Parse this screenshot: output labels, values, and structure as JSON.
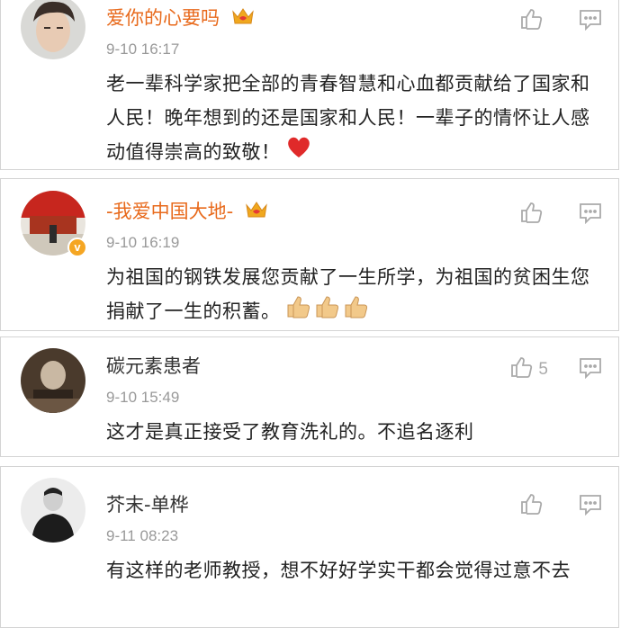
{
  "comments": [
    {
      "username": "爱你的心要吗",
      "time": "9-10 16:17",
      "text": "老一辈科学家把全部的青春智慧和心血都贡献给了国家和人民！晚年想到的还是国家和人民！一辈子的情怀让人感动值得崇高的致敬！",
      "like_count": "",
      "emoji": "heart-emoji"
    },
    {
      "username": "-我爱中国大地-",
      "time": "9-10 16:19",
      "text": "为祖国的钢铁发展您贡献了一生所学，为祖国的贫困生您捐献了一生的积蓄。",
      "like_count": "",
      "emoji": "thumbs-up-emoji"
    },
    {
      "username": "碳元素患者",
      "time": "9-10 15:49",
      "text": "这才是真正接受了教育洗礼的。不追名逐利",
      "like_count": "5"
    },
    {
      "username": "芥末-单桦",
      "time": "9-11 08:23",
      "text": "有这样的老师教授，想不好好学实干都会觉得过意不去",
      "like_count": ""
    }
  ],
  "colors": {
    "vip_name": "#e86a1c",
    "timestamp": "#999999",
    "icon": "#aaaaaa",
    "heart": "#e02a2a",
    "verified_badge": "#f5a623"
  }
}
